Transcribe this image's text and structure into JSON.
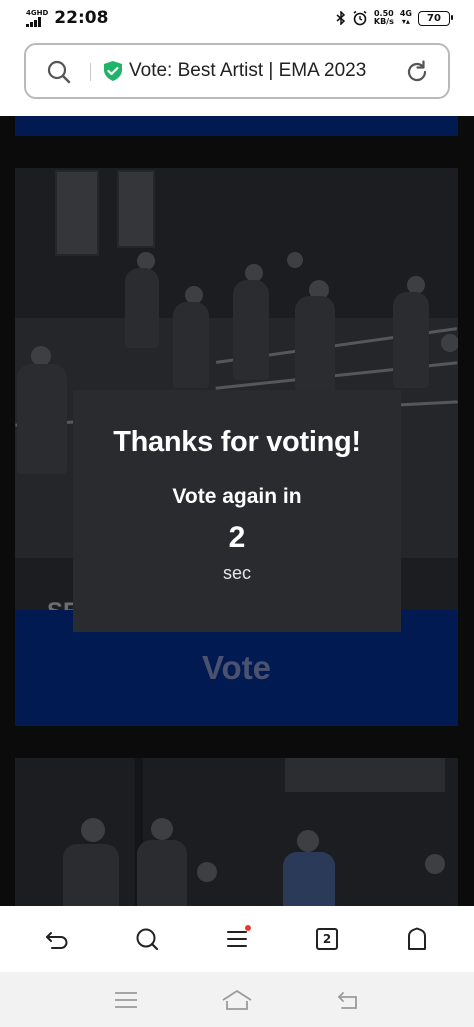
{
  "status_bar": {
    "network": "4GHD",
    "time": "22:08",
    "speed_value": "0.50",
    "speed_unit": "KB/s",
    "network_right": "4G",
    "battery": "70",
    "icons": [
      "signal-icon",
      "bluetooth-icon",
      "alarm-icon",
      "battery-icon"
    ]
  },
  "browser": {
    "page_title": "Vote: Best Artist | EMA 2023",
    "secure_icon": "shield-check-icon",
    "secure_color": "#1fb46a"
  },
  "content": {
    "card_partial_text": "SE",
    "vote_button": "Vote",
    "vote_color": "#021a52"
  },
  "modal": {
    "title": "Thanks for voting!",
    "subtitle": "Vote again in",
    "countdown": "2",
    "unit": "sec"
  },
  "toolbar": {
    "tab_count": "2",
    "icons": [
      "back-icon",
      "search-icon",
      "menu-icon",
      "tabs-icon",
      "home-icon"
    ],
    "notification_color": "#e63b2e"
  },
  "navbar": {
    "icons": [
      "recents-icon",
      "home-icon",
      "back-icon"
    ]
  }
}
